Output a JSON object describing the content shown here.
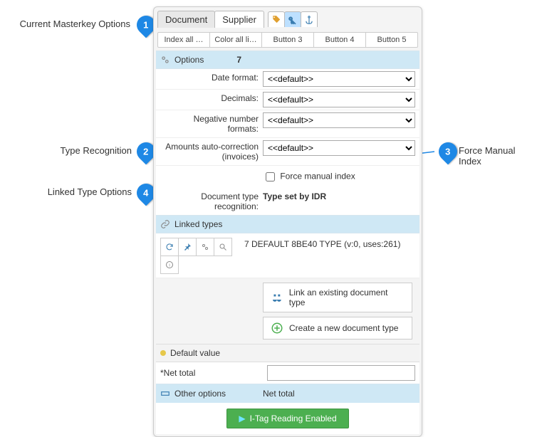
{
  "callouts": {
    "c1": "Current Masterkey Options",
    "c2": "Type Recognition",
    "c3": "Force Manual Index",
    "c4": "Linked Type Options",
    "n1": "1",
    "n2": "2",
    "n3": "3",
    "n4": "4"
  },
  "main_tabs": {
    "document": "Document",
    "supplier": "Supplier"
  },
  "sub_tabs": [
    "Index all …",
    "Color all li…",
    "Button 3",
    "Button 4",
    "Button 5"
  ],
  "options": {
    "title": "Options",
    "count": "7",
    "rows": {
      "date_format": {
        "label": "Date format:",
        "value": "<<default>>"
      },
      "decimals": {
        "label": "Decimals:",
        "value": "<<default>>"
      },
      "neg": {
        "label": "Negative number formats:",
        "value": "<<default>>"
      },
      "amounts": {
        "label": "Amounts auto-correction (invoices)",
        "value": "<<default>>"
      }
    },
    "force_label": "Force manual index",
    "doc_type_label": "Document type recognition:",
    "doc_type_value": "Type set by IDR"
  },
  "linked": {
    "title": "Linked types",
    "desc": "7 DEFAULT 8BE40 TYPE (v:0, uses:261)",
    "link_existing": "Link an existing document type",
    "create_new": "Create a new document type"
  },
  "default_value": {
    "title": "Default value",
    "net_label": "*Net total"
  },
  "other": {
    "title": "Other options",
    "value": "Net total"
  },
  "itag_btn": "I-Tag Reading Enabled"
}
